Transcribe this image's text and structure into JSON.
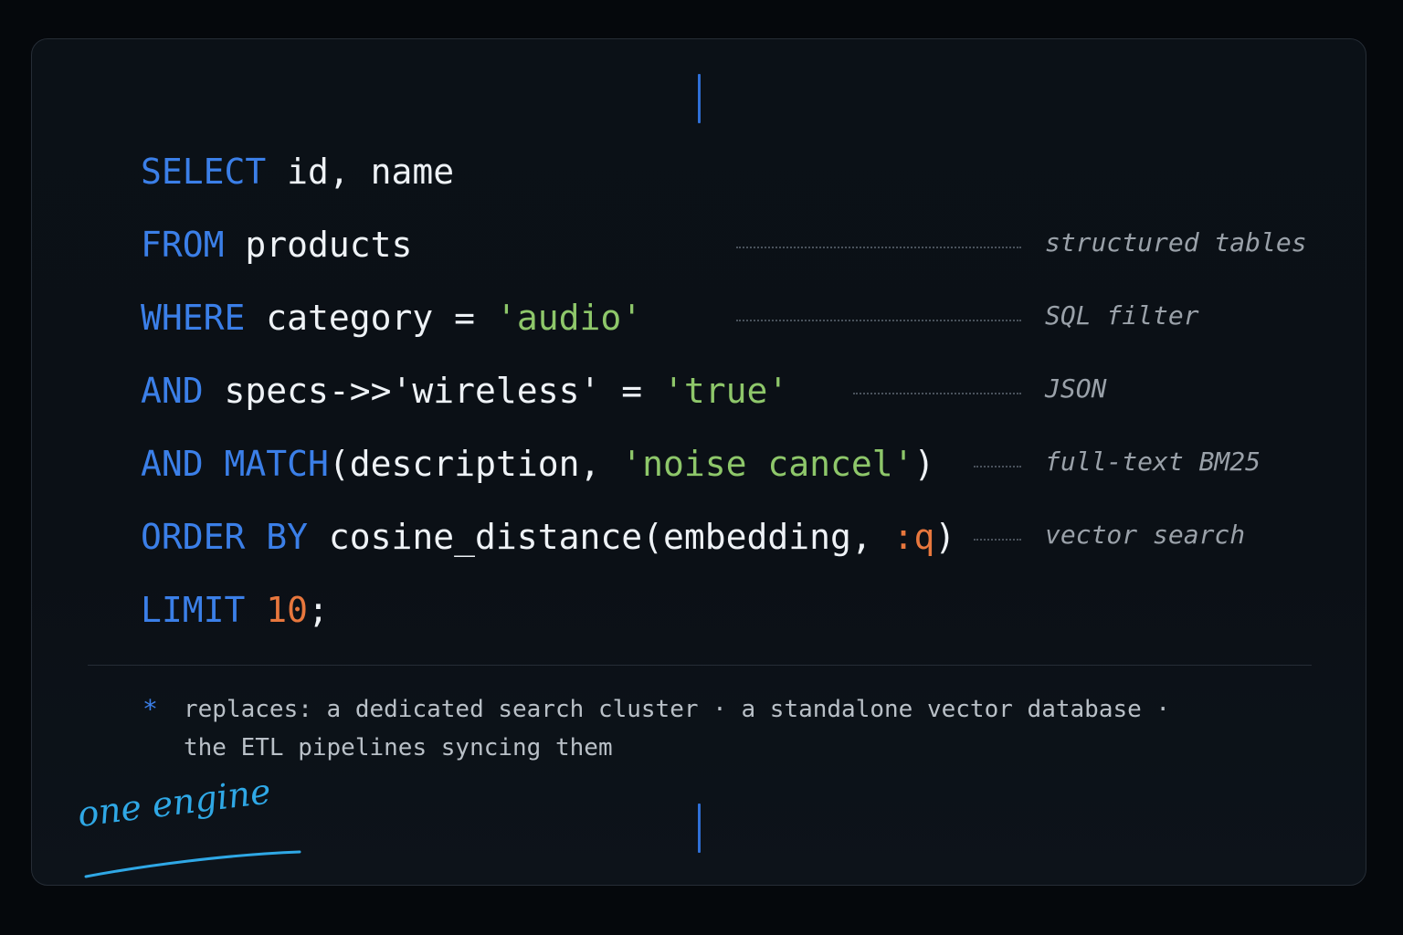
{
  "code": {
    "line1": {
      "kw": "SELECT",
      "rest": " id, name"
    },
    "line2": {
      "kw": "FROM",
      "rest": " products"
    },
    "line3": {
      "kw": "WHERE",
      "rest": " category = ",
      "str": "'audio'"
    },
    "line4": {
      "kw": "AND",
      "rest": " specs->>'wireless' = ",
      "str": "'true'"
    },
    "line5": {
      "kw": "AND",
      "kw2": "MATCH",
      "rest": "(description, ",
      "str": "'noise cancel'",
      "end": ")"
    },
    "line6": {
      "kw": "ORDER BY",
      "rest": " cosine_distance(embedding, ",
      "param": ":q",
      "end": ")"
    },
    "line7": {
      "kw": "LIMIT",
      "num": "10",
      "end": ";"
    }
  },
  "annotations": {
    "structured": "structured tables",
    "sql_filter": "SQL filter",
    "json": "JSON",
    "fulltext": "full-text BM25",
    "vector": "vector search"
  },
  "note": {
    "star": "*",
    "line1": "replaces: a dedicated search cluster · a standalone vector database ·",
    "line2": "the ETL pipelines syncing them"
  },
  "handwritten_label": "one engine",
  "colors": {
    "keyword": "#3b7fe8",
    "string": "#8ec76a",
    "number": "#e8773d",
    "accent_handwriting": "#2fa8e6"
  }
}
